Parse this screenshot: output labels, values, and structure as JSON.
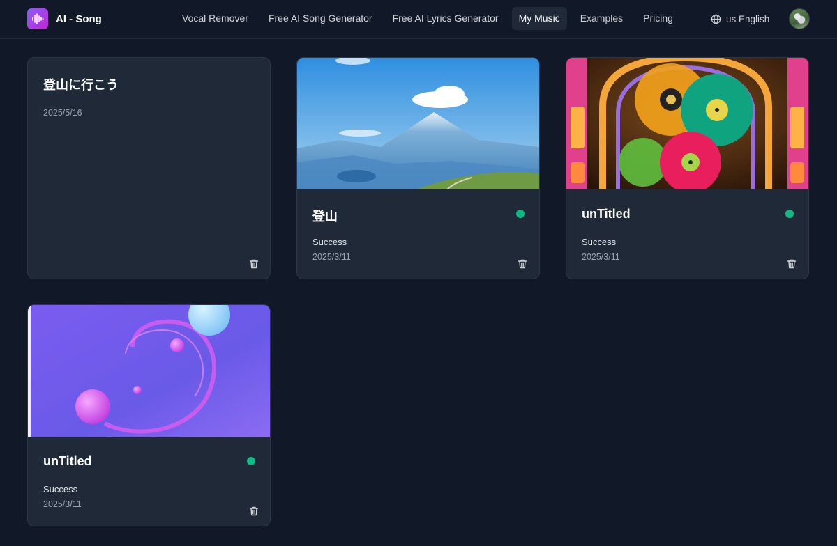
{
  "header": {
    "brand": "AI - Song",
    "nav": [
      {
        "label": "Vocal Remover"
      },
      {
        "label": "Free AI Song Generator"
      },
      {
        "label": "Free AI Lyrics Generator"
      },
      {
        "label": "My Music"
      },
      {
        "label": "Examples"
      },
      {
        "label": "Pricing"
      }
    ],
    "active_nav": "My Music",
    "language": "us English"
  },
  "songs": [
    {
      "title": "登山に行こう",
      "status": "",
      "date": "2025/5/16"
    },
    {
      "title": "登山",
      "status": "Success",
      "date": "2025/3/11"
    },
    {
      "title": "unTitled",
      "status": "Success",
      "date": "2025/3/11"
    },
    {
      "title": "unTitled",
      "status": "Success",
      "date": "2025/3/11"
    }
  ],
  "colors": {
    "background": "#111827",
    "card": "#1f2937",
    "success_dot": "#10b981",
    "brand_gradient_start": "#8b5cf6",
    "brand_gradient_end": "#c026d3"
  },
  "icons": {
    "logo": "waveform-icon",
    "language": "globe-icon",
    "delete": "trash-icon",
    "status": "status-dot-icon"
  }
}
